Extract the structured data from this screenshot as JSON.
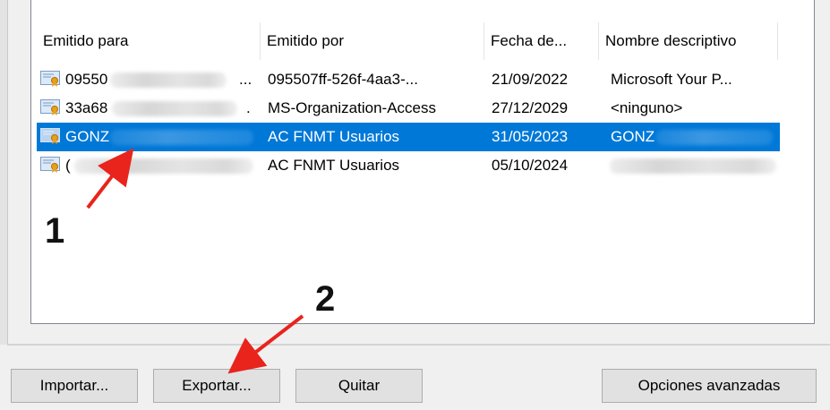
{
  "columns": [
    {
      "label": "Emitido para"
    },
    {
      "label": "Emitido por"
    },
    {
      "label": "Fecha de..."
    },
    {
      "label": "Nombre descriptivo"
    }
  ],
  "rows": [
    {
      "issued_to": "09550",
      "issued_to_suffix": "...",
      "issued_by": "095507ff-526f-4aa3-...",
      "date": "21/09/2022",
      "friendly_name": "Microsoft Your P...",
      "selected": false
    },
    {
      "issued_to": "33a68",
      "issued_to_suffix": ".",
      "issued_by": "MS-Organization-Access",
      "date": "27/12/2029",
      "friendly_name": "<ninguno>",
      "selected": false
    },
    {
      "issued_to": "GONZ",
      "issued_to_suffix": "",
      "issued_by": "AC FNMT Usuarios",
      "date": "31/05/2023",
      "friendly_name": "GONZ",
      "selected": true
    },
    {
      "issued_to": "(",
      "issued_to_suffix": "",
      "issued_by": "AC FNMT Usuarios",
      "date": "05/10/2024",
      "friendly_name": "",
      "selected": false
    }
  ],
  "buttons": {
    "import": "Importar...",
    "export": "Exportar...",
    "remove": "Quitar",
    "advanced": "Opciones avanzadas"
  },
  "annotations": {
    "step1": "1",
    "step2": "2"
  },
  "colors": {
    "selection": "#0078d7",
    "arrow": "#e8241c"
  },
  "icons": {
    "row_icon": "certificate-icon"
  }
}
